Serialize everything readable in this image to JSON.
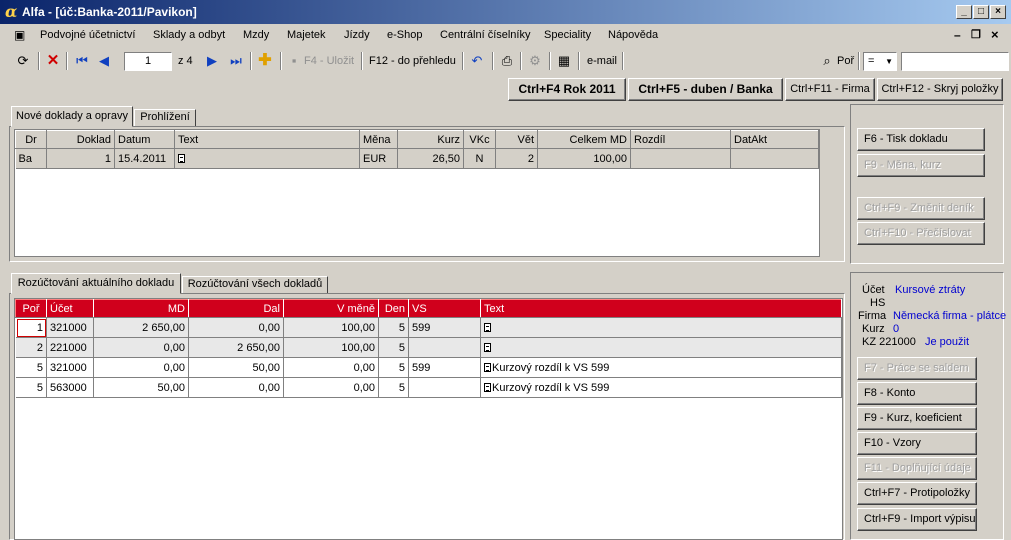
{
  "window": {
    "title": "Alfa - [úč:Banka-2011/Pavikon]",
    "logo_glyph": "α"
  },
  "menu": [
    "Podvojné účetnictví",
    "Sklady a odbyt",
    "Mzdy",
    "Majetek",
    "Jízdy",
    "e-Shop",
    "Centrální číselníky",
    "Speciality",
    "Nápověda"
  ],
  "toolbar": {
    "record_value": "1",
    "record_total": "z 4",
    "save_label": "F4 - Uložit",
    "overview_label": "F12 - do přehledu",
    "email_label": "e-mail",
    "por_label": "Poř",
    "eq_label": "=",
    "search_value": ""
  },
  "action_buttons": {
    "rok": "Ctrl+F4 Rok 2011",
    "duben": "Ctrl+F5 - duben / Banka",
    "firma": "Ctrl+F11 - Firma",
    "skryj": "Ctrl+F12 - Skryj položky"
  },
  "top_tabs": [
    "Nové doklady a opravy",
    "Prohlížení"
  ],
  "doc_table": {
    "headers": [
      "Dr",
      "Doklad",
      "Datum",
      "Text",
      "Měna",
      "Kurz",
      "VKc",
      "Vět",
      "Celkem MD",
      "Rozdíl",
      "DatAkt"
    ],
    "rows": [
      [
        "Ba",
        "1",
        "15.4.2011",
        "",
        "EUR",
        "26,50",
        "N",
        "2",
        "100,00",
        "",
        ""
      ]
    ]
  },
  "right_top_buttons": {
    "tisk": "F6 - Tisk dokladu",
    "mena": "F9 - Měna, kurz",
    "denik": "Ctrl+F9 - Změnit deník",
    "precislovat": "Ctrl+F10 - Přečíslovat"
  },
  "bottom_tabs": [
    "Rozúčtování aktuálního dokladu",
    "Rozúčtování všech dokladů"
  ],
  "entry_table": {
    "headers": [
      "Poř",
      "Účet",
      "MD",
      "Dal",
      "V měně",
      "Den",
      "VS",
      "Text"
    ],
    "rows": [
      [
        "1",
        "321000",
        "2 650,00",
        "0,00",
        "100,00",
        "5",
        "599",
        ""
      ],
      [
        "2",
        "221000",
        "0,00",
        "2 650,00",
        "100,00",
        "5",
        "",
        ""
      ],
      [
        "5",
        "321000",
        "0,00",
        "50,00",
        "0,00",
        "5",
        "599",
        "Kurzový rozdíl k VS 599"
      ],
      [
        "5",
        "563000",
        "50,00",
        "0,00",
        "0,00",
        "5",
        "",
        "Kurzový rozdíl k VS 599"
      ]
    ]
  },
  "info": {
    "ucet_label": "Účet",
    "ucet_value": "Kursové ztráty",
    "hs_label": "HS",
    "firma_label": "Firma",
    "firma_value": "Německá firma - plátce",
    "kurz_label": "Kurz",
    "kurz_value": "0",
    "kz_label": "KZ 221000",
    "kz_value": "Je použit"
  },
  "right_bottom_buttons": {
    "saldo": "F7 - Práce se saldem",
    "konto": "F8 - Konto",
    "kurz": "F9 - Kurz, koeficient",
    "vzory": "F10 - Vzory",
    "doplnujici": "F11 - Doplňující údaje",
    "protipolozky": "Ctrl+F7 - Protipoložky",
    "import": "Ctrl+F9 - Import výpisu"
  }
}
